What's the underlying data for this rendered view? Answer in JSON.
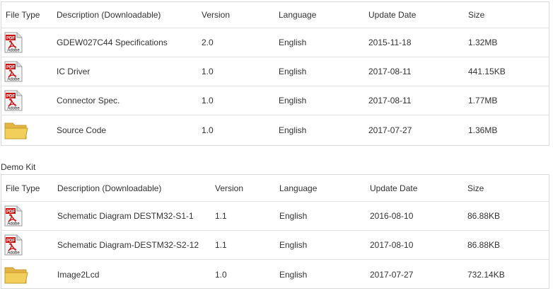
{
  "tables": [
    {
      "headers": [
        "File Type",
        "Description (Downloadable)",
        "Version",
        "Language",
        "Update Date",
        "Size"
      ],
      "rows": [
        {
          "icon": "pdf-icon",
          "description": "GDEW027C44 Specifications",
          "version": "2.0",
          "language": "English",
          "date": "2015-11-18",
          "size": "1.32MB"
        },
        {
          "icon": "pdf-icon",
          "description": "IC Driver",
          "version": "1.0",
          "language": "English",
          "date": "2017-08-11",
          "size": "441.15KB"
        },
        {
          "icon": "pdf-icon",
          "description": "Connector Spec.",
          "version": "1.0",
          "language": "English",
          "date": "2017-08-11",
          "size": "1.77MB"
        },
        {
          "icon": "folder-icon",
          "description": "Source Code",
          "version": "1.0",
          "language": "English",
          "date": "2017-07-27",
          "size": "1.36MB"
        }
      ]
    },
    {
      "section_title": "Demo Kit",
      "headers": [
        "File Type",
        "Description (Downloadable)",
        "Version",
        "Language",
        "Update Date",
        "Size"
      ],
      "rows": [
        {
          "icon": "pdf-icon",
          "description": "Schematic Diagram DESTM32-S1-1",
          "version": "1.1",
          "language": "English",
          "date": "2016-08-10",
          "size": "86.88KB"
        },
        {
          "icon": "pdf-icon",
          "description": "Schematic Diagram-DESTM32-S2-12",
          "version": "1.1",
          "language": "English",
          "date": "2017-08-10",
          "size": "86.88KB"
        },
        {
          "icon": "folder-icon",
          "description": "Image2Lcd",
          "version": "1.0",
          "language": "English",
          "date": "2017-07-27",
          "size": "732.14KB"
        }
      ]
    }
  ],
  "icon_labels": {
    "pdf_badge": "PDF",
    "adobe": "Adobe"
  },
  "colors": {
    "pdf_red": "#cc1111",
    "folder_yellow": "#f2cf5b",
    "border": "#d9d9d9"
  }
}
